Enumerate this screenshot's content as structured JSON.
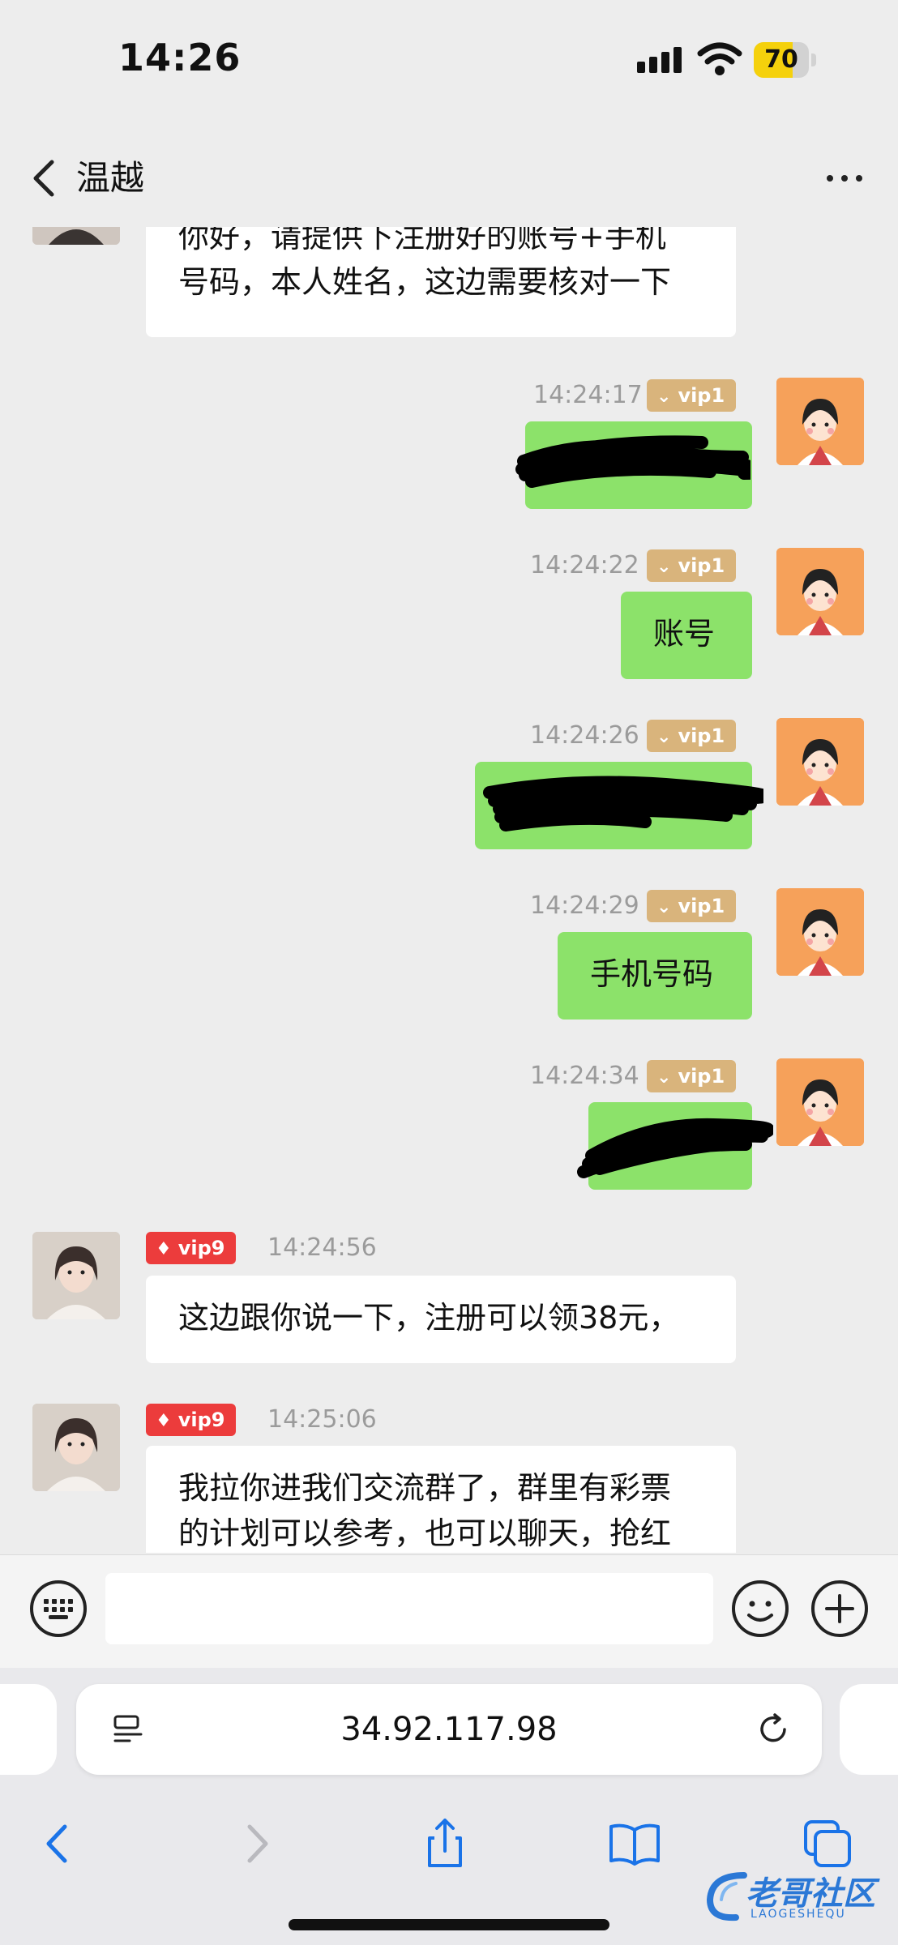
{
  "status_bar": {
    "time": "14:26",
    "battery": "70",
    "battery_level_percent": 70
  },
  "header": {
    "title": "温越"
  },
  "messages": [
    {
      "side": "in",
      "text_lines": [
        "你好，请提供下注册好的账号+手机",
        "号码，本人姓名，这边需要核对一下"
      ]
    },
    {
      "side": "out",
      "timestamp": "14:24:17",
      "vip": "vip1",
      "redacted": true
    },
    {
      "side": "out",
      "timestamp": "14:24:22",
      "vip": "vip1",
      "text": "账号"
    },
    {
      "side": "out",
      "timestamp": "14:24:26",
      "vip": "vip1",
      "redacted": true
    },
    {
      "side": "out",
      "timestamp": "14:24:29",
      "vip": "vip1",
      "text": "手机号码"
    },
    {
      "side": "out",
      "timestamp": "14:24:34",
      "vip": "vip1",
      "redacted": true
    },
    {
      "side": "in",
      "timestamp": "14:24:56",
      "vip": "vip9",
      "text": "这边跟你说一下，注册可以领38元，"
    },
    {
      "side": "in",
      "timestamp": "14:25:06",
      "vip": "vip9",
      "text_lines": [
        "我拉你进我们交流群了，群里有彩票",
        "的计划可以参考，也可以聊天，抢红"
      ]
    }
  ],
  "input": {
    "placeholder": ""
  },
  "browser": {
    "url": "34.92.117.98"
  },
  "watermark": {
    "text": "老哥社区",
    "sub": "LAOGESHEQU"
  },
  "colors": {
    "bubble_out": "#8ce26a",
    "vip1": "#d9b47c",
    "vip9": "#ec3c3c",
    "link_blue": "#2b78d6"
  },
  "icons": [
    "back-chevron-icon",
    "more-icon",
    "keyboard-icon",
    "emoji-icon",
    "plus-icon",
    "reader-icon",
    "reload-icon",
    "browser-back-icon",
    "browser-forward-icon",
    "share-icon",
    "bookmarks-icon",
    "tabs-icon"
  ]
}
